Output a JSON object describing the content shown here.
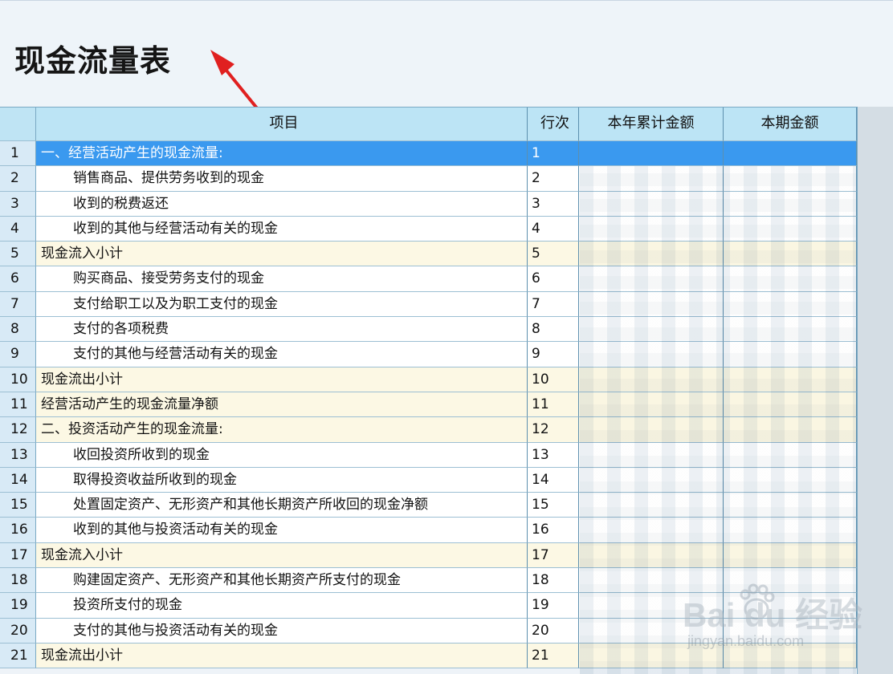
{
  "title": "现金流量表",
  "table": {
    "headers": {
      "item": "项目",
      "line": "行次",
      "ytd": "本年累计金额",
      "current": "本期金额"
    },
    "rows": [
      {
        "num": "1",
        "item": "一、经营活动产生的现金流量:",
        "line": "1",
        "style": "selected",
        "indent": false
      },
      {
        "num": "2",
        "item": "销售商品、提供劳务收到的现金",
        "line": "2",
        "style": "white",
        "indent": true
      },
      {
        "num": "3",
        "item": "收到的税费返还",
        "line": "3",
        "style": "white",
        "indent": true
      },
      {
        "num": "4",
        "item": "收到的其他与经营活动有关的现金",
        "line": "4",
        "style": "white",
        "indent": true
      },
      {
        "num": "5",
        "item": "现金流入小计",
        "line": "5",
        "style": "yellow",
        "indent": false
      },
      {
        "num": "6",
        "item": "购买商品、接受劳务支付的现金",
        "line": "6",
        "style": "white",
        "indent": true
      },
      {
        "num": "7",
        "item": "支付给职工以及为职工支付的现金",
        "line": "7",
        "style": "white",
        "indent": true
      },
      {
        "num": "8",
        "item": "支付的各项税费",
        "line": "8",
        "style": "white",
        "indent": true
      },
      {
        "num": "9",
        "item": "支付的其他与经营活动有关的现金",
        "line": "9",
        "style": "white",
        "indent": true
      },
      {
        "num": "10",
        "item": "现金流出小计",
        "line": "10",
        "style": "yellow",
        "indent": false
      },
      {
        "num": "11",
        "item": "经营活动产生的现金流量净额",
        "line": "11",
        "style": "yellow",
        "indent": false
      },
      {
        "num": "12",
        "item": "二、投资活动产生的现金流量:",
        "line": "12",
        "style": "yellow",
        "indent": false
      },
      {
        "num": "13",
        "item": "收回投资所收到的现金",
        "line": "13",
        "style": "white",
        "indent": true
      },
      {
        "num": "14",
        "item": "取得投资收益所收到的现金",
        "line": "14",
        "style": "white",
        "indent": true
      },
      {
        "num": "15",
        "item": "处置固定资产、无形资产和其他长期资产所收回的现金净额",
        "line": "15",
        "style": "white",
        "indent": true
      },
      {
        "num": "16",
        "item": "收到的其他与投资活动有关的现金",
        "line": "16",
        "style": "white",
        "indent": true
      },
      {
        "num": "17",
        "item": "现金流入小计",
        "line": "17",
        "style": "yellow",
        "indent": false
      },
      {
        "num": "18",
        "item": "购建固定资产、无形资产和其他长期资产所支付的现金",
        "line": "18",
        "style": "white",
        "indent": true
      },
      {
        "num": "19",
        "item": "投资所支付的现金",
        "line": "19",
        "style": "white",
        "indent": true
      },
      {
        "num": "20",
        "item": "支付的其他与投资活动有关的现金",
        "line": "20",
        "style": "white",
        "indent": true
      },
      {
        "num": "21",
        "item": "现金流出小计",
        "line": "21",
        "style": "yellow",
        "indent": false
      }
    ]
  },
  "watermark": {
    "brand": "Bai du 经验",
    "url": "jingyan.baidu.com"
  },
  "colors": {
    "selected": "#3a99ef",
    "header": "#bce4f5",
    "subtotal": "#fcf8e4",
    "annotation_arrow": "#e02020"
  }
}
